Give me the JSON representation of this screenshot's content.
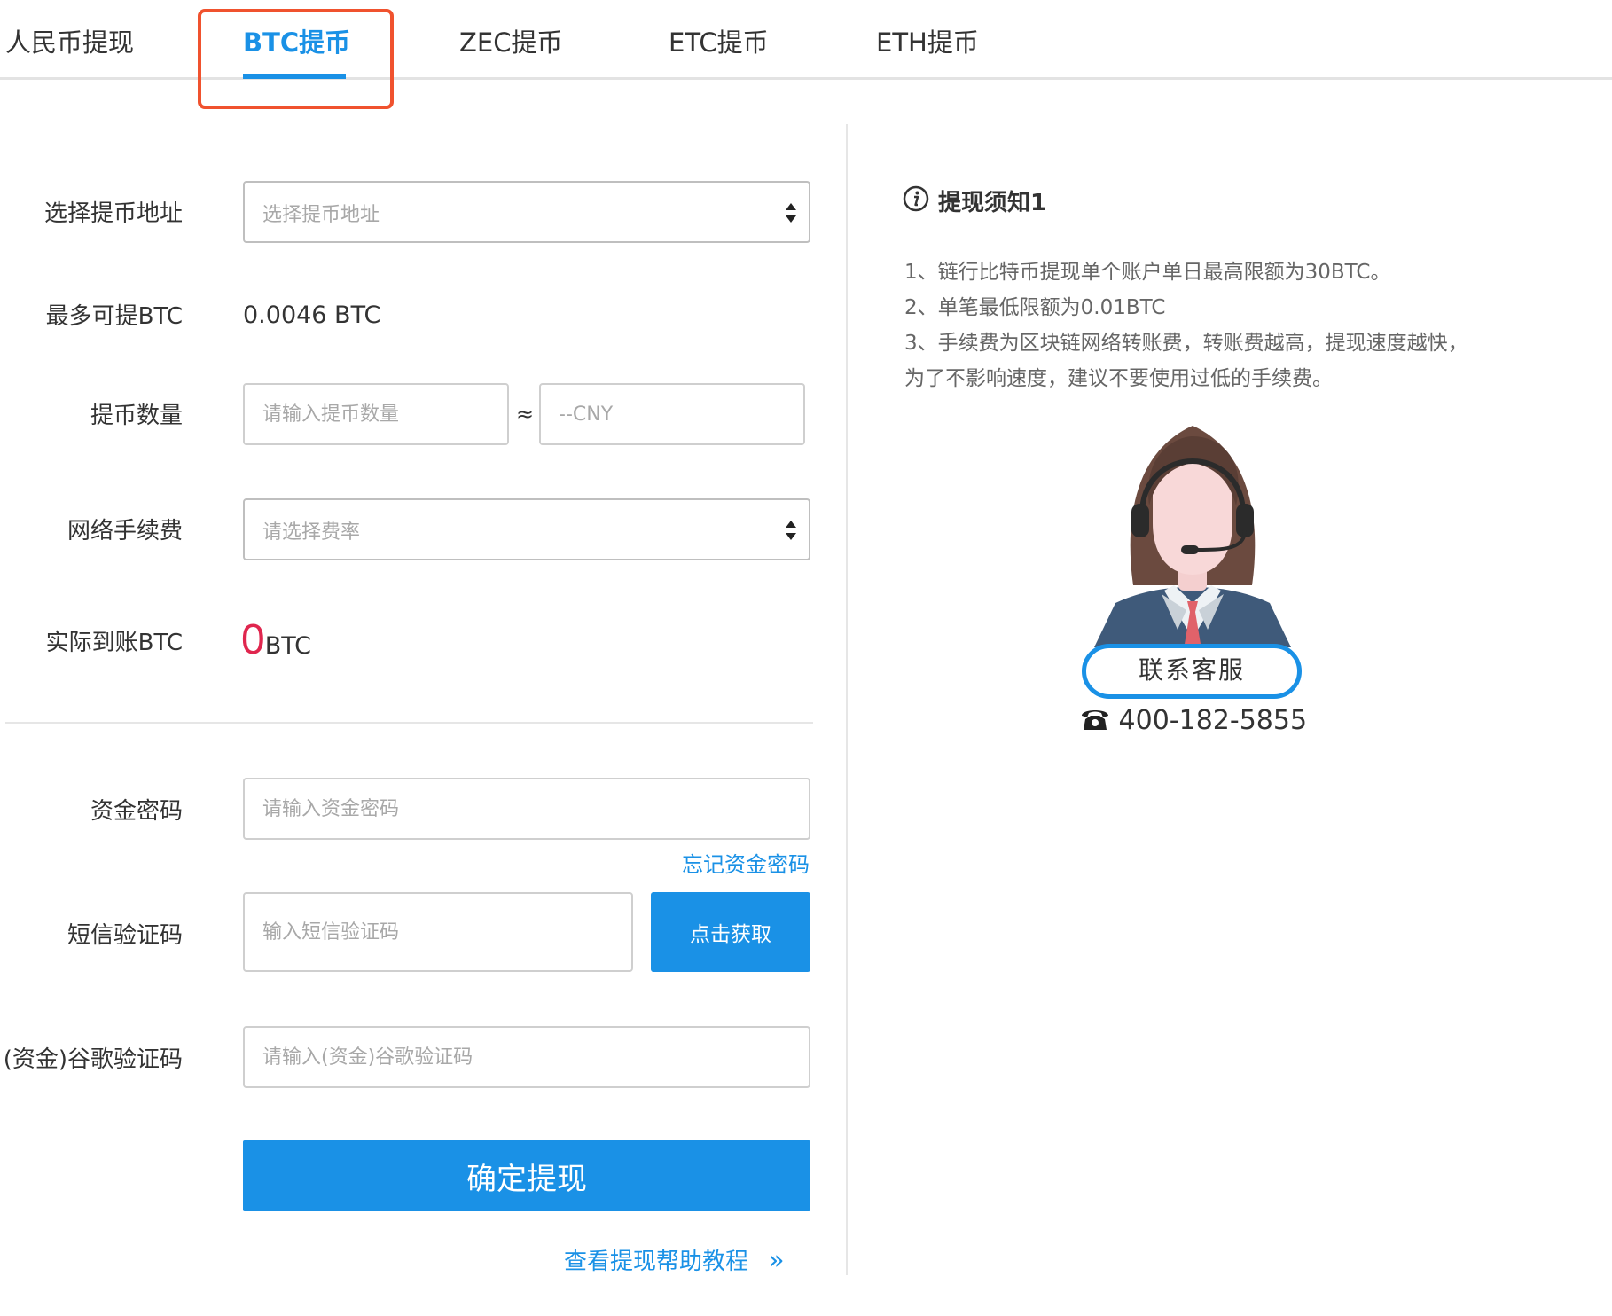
{
  "tabs": [
    {
      "label": "人民币提现"
    },
    {
      "label": "BTC提币",
      "active": true
    },
    {
      "label": "ZEC提币"
    },
    {
      "label": "ETC提币"
    },
    {
      "label": "ETH提币"
    }
  ],
  "form": {
    "address": {
      "label": "选择提币地址",
      "placeholder": "选择提币地址"
    },
    "max": {
      "label": "最多可提BTC",
      "value": "0.0046 BTC"
    },
    "amount": {
      "label": "提币数量",
      "placeholder": "请输入提币数量",
      "approx": "≈",
      "cny_placeholder": "--CNY"
    },
    "fee": {
      "label": "网络手续费",
      "placeholder": "请选择费率"
    },
    "actual": {
      "label": "实际到账BTC",
      "value": "0",
      "unit": "BTC"
    },
    "fund_password": {
      "label": "资金密码",
      "placeholder": "请输入资金密码",
      "forgot_link": "忘记资金密码"
    },
    "sms": {
      "label": "短信验证码",
      "placeholder": "输入短信验证码",
      "button": "点击获取"
    },
    "google": {
      "label": "(资金)谷歌验证码",
      "placeholder": "请输入(资金)谷歌验证码"
    },
    "submit_label": "确定提现",
    "help_link": "查看提现帮助教程",
    "help_arrow": "»"
  },
  "notice": {
    "title": "提现须知1",
    "lines": [
      "1、链行比特币提现单个账户单日最高限额为30BTC。",
      "2、单笔最低限额为0.01BTC",
      "3、手续费为区块链网络转账费，转账费越高，提现速度越快，",
      "为了不影响速度，建议不要使用过低的手续费。"
    ]
  },
  "support": {
    "button": "联系客服",
    "phone": "400-182-5855"
  },
  "colors": {
    "accent": "#1a91e6",
    "highlight_border": "#f0522e",
    "zero_value": "#e0264e"
  },
  "icons": [
    "info-icon",
    "sort-arrows-icon",
    "phone-icon",
    "customer-service-agent-icon"
  ]
}
